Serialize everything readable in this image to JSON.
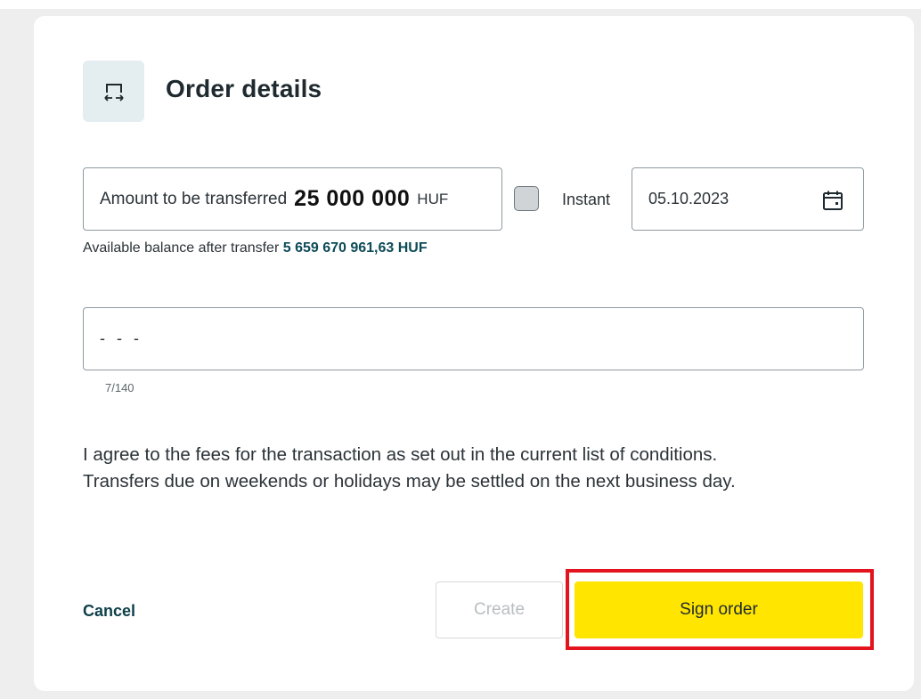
{
  "header": {
    "title": "Order details",
    "icon": "transfer-icon"
  },
  "amount": {
    "label": "Amount to be transferred",
    "value": "25 000 000",
    "currency": "HUF"
  },
  "instant": {
    "label": "Instant",
    "checked": false
  },
  "date": {
    "value": "05.10.2023",
    "icon": "calendar-icon"
  },
  "balance": {
    "label": "Available balance after transfer",
    "value": "5 659 670 961,63 HUF"
  },
  "memo": {
    "value": "- - -",
    "counter": "7/140"
  },
  "terms": {
    "line1": "I agree to the fees for the transaction as set out in the current list of conditions.",
    "line2": "Transfers due on weekends or holidays may be settled on the next business day."
  },
  "actions": {
    "cancel_label": "Cancel",
    "create_label": "Create",
    "sign_label": "Sign order"
  },
  "colors": {
    "accent_yellow": "#ffe500",
    "highlight_red": "#e3141d",
    "link_teal": "#0d4b57"
  }
}
